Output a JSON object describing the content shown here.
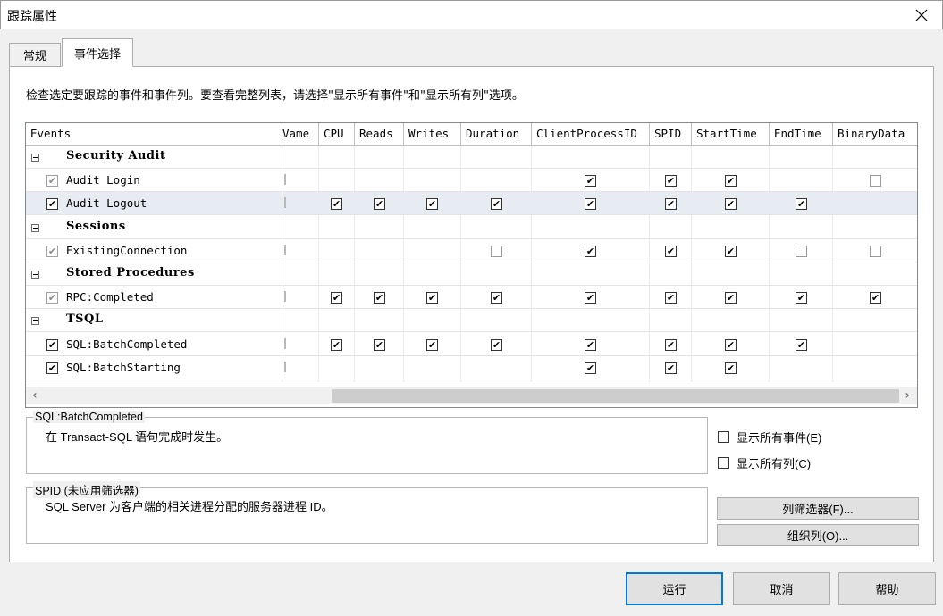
{
  "window": {
    "title": "跟踪属性",
    "close_glyph": "✕"
  },
  "tabs": [
    {
      "label": "常规",
      "active": false
    },
    {
      "label": "事件选择",
      "active": true
    }
  ],
  "instructions": "检查选定要跟踪的事件和事件列。要查看完整列表，请选择\"显示所有事件\"和\"显示所有列\"选项。",
  "grid": {
    "columns": [
      "Events",
      "Name",
      "CPU",
      "Reads",
      "Writes",
      "Duration",
      "ClientProcessID",
      "SPID",
      "StartTime",
      "EndTime",
      "BinaryData"
    ],
    "column_header_partial": "Vame",
    "groups": [
      {
        "name": "Security Audit",
        "events": [
          {
            "name": "Audit Login",
            "event_check": "grey",
            "selected": false,
            "cells": {
              "ClientProcessID": "checked",
              "SPID": "checked",
              "StartTime": "checked",
              "BinaryData": "empty"
            }
          },
          {
            "name": "Audit Logout",
            "event_check": "checked",
            "selected": true,
            "cells": {
              "CPU": "checked",
              "Reads": "checked",
              "Writes": "checked",
              "Duration": "checked",
              "ClientProcessID": "checked",
              "SPID": "checked",
              "StartTime": "checked",
              "EndTime": "checked"
            }
          }
        ]
      },
      {
        "name": "Sessions",
        "events": [
          {
            "name": "ExistingConnection",
            "event_check": "grey",
            "selected": false,
            "cells": {
              "Duration": "empty",
              "ClientProcessID": "checked",
              "SPID": "checked",
              "StartTime": "checked",
              "EndTime": "empty",
              "BinaryData": "empty"
            }
          }
        ]
      },
      {
        "name": "Stored Procedures",
        "events": [
          {
            "name": "RPC:Completed",
            "event_check": "grey",
            "selected": false,
            "cells": {
              "CPU": "checked",
              "Reads": "checked",
              "Writes": "checked",
              "Duration": "checked",
              "ClientProcessID": "checked",
              "SPID": "checked",
              "StartTime": "checked",
              "EndTime": "checked",
              "BinaryData": "checked"
            }
          }
        ]
      },
      {
        "name": "TSQL",
        "events": [
          {
            "name": "SQL:BatchCompleted",
            "event_check": "checked",
            "selected": false,
            "cells": {
              "CPU": "checked",
              "Reads": "checked",
              "Writes": "checked",
              "Duration": "checked",
              "ClientProcessID": "checked",
              "SPID": "checked",
              "StartTime": "checked",
              "EndTime": "checked"
            }
          },
          {
            "name": "SQL:BatchStarting",
            "event_check": "checked",
            "selected": false,
            "cells": {
              "ClientProcessID": "checked",
              "SPID": "checked",
              "StartTime": "checked"
            }
          }
        ]
      }
    ],
    "scroll_left_glyph": "‹",
    "scroll_right_glyph": "›"
  },
  "event_info": {
    "title": "SQL:BatchCompleted",
    "description": "在 Transact-SQL 语句完成时发生。"
  },
  "column_info": {
    "title": "SPID (未应用筛选器)",
    "description": "SQL Server 为客户端的相关进程分配的服务器进程 ID。"
  },
  "options": {
    "show_all_events": "显示所有事件(E)",
    "show_all_columns": "显示所有列(C)"
  },
  "side_buttons": {
    "column_filters": "列筛选器(F)...",
    "organize_columns": "组织列(O)..."
  },
  "footer_buttons": {
    "run": "运行",
    "cancel": "取消",
    "help": "帮助"
  },
  "icons": {
    "close": "close-icon",
    "expander": "collapse-icon",
    "check": "checkmark-icon"
  },
  "colors": {
    "selected_row": "#e6ecf2",
    "default_button_border": "#0078d7"
  }
}
